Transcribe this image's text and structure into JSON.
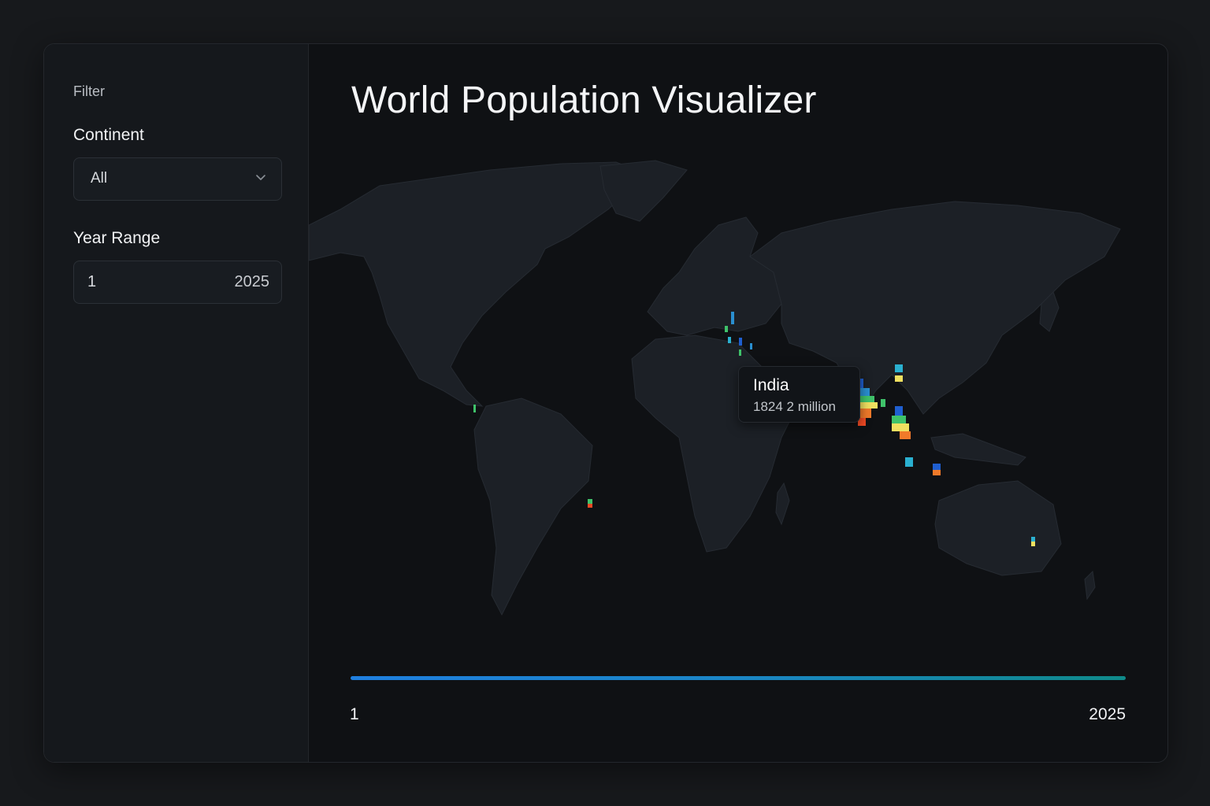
{
  "sidebar": {
    "heading": "Filter",
    "continent": {
      "label": "Continent",
      "value": "All"
    },
    "year_range": {
      "label": "Year Range",
      "min": "1",
      "max": "2025"
    }
  },
  "main": {
    "title": "World Population Visualizer",
    "tooltip": {
      "country": "India",
      "value": "1824 2 million"
    },
    "timeline": {
      "start_label": "1",
      "end_label": "2025"
    }
  },
  "colors": {
    "land": "#1c2026",
    "background": "#0f1114",
    "timeline_start": "#1f7fe0",
    "timeline_end": "#0f8a8a",
    "heat_low": "#1f5fd0",
    "heat_mid": "#3fc26a",
    "heat_high": "#f0e060",
    "heat_peak": "#f04a24"
  },
  "icons": {
    "select_chevron": "chevron-down-icon"
  }
}
